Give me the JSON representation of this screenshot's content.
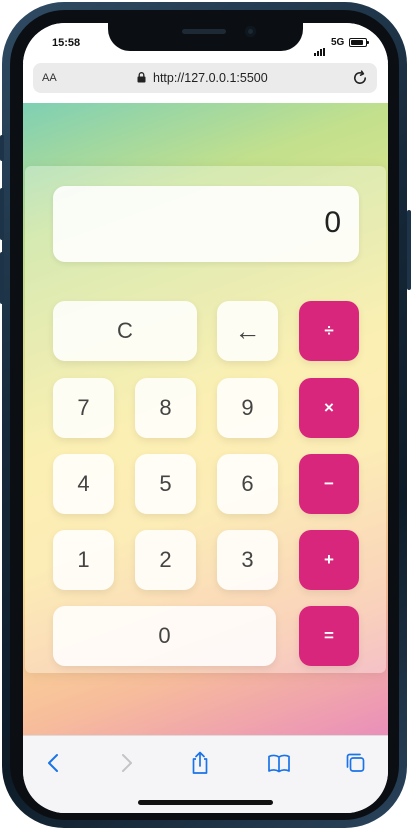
{
  "status_bar": {
    "time": "15:58",
    "network": "5G"
  },
  "browser": {
    "text_size_label": "AA",
    "url": "http://127.0.0.1:5500"
  },
  "calculator": {
    "display": "0",
    "keys": {
      "clear": "C",
      "backspace": "←",
      "divide": "÷",
      "seven": "7",
      "eight": "8",
      "nine": "9",
      "multiply": "×",
      "four": "4",
      "five": "5",
      "six": "6",
      "minus": "−",
      "one": "1",
      "two": "2",
      "three": "3",
      "plus": "+",
      "zero": "0",
      "equals": "="
    }
  },
  "colors": {
    "operator": "#d8267c",
    "browser_accent": "#1a73e8"
  },
  "toolbar_icons": [
    "back-icon",
    "forward-icon",
    "share-icon",
    "bookmarks-icon",
    "tabs-icon"
  ]
}
